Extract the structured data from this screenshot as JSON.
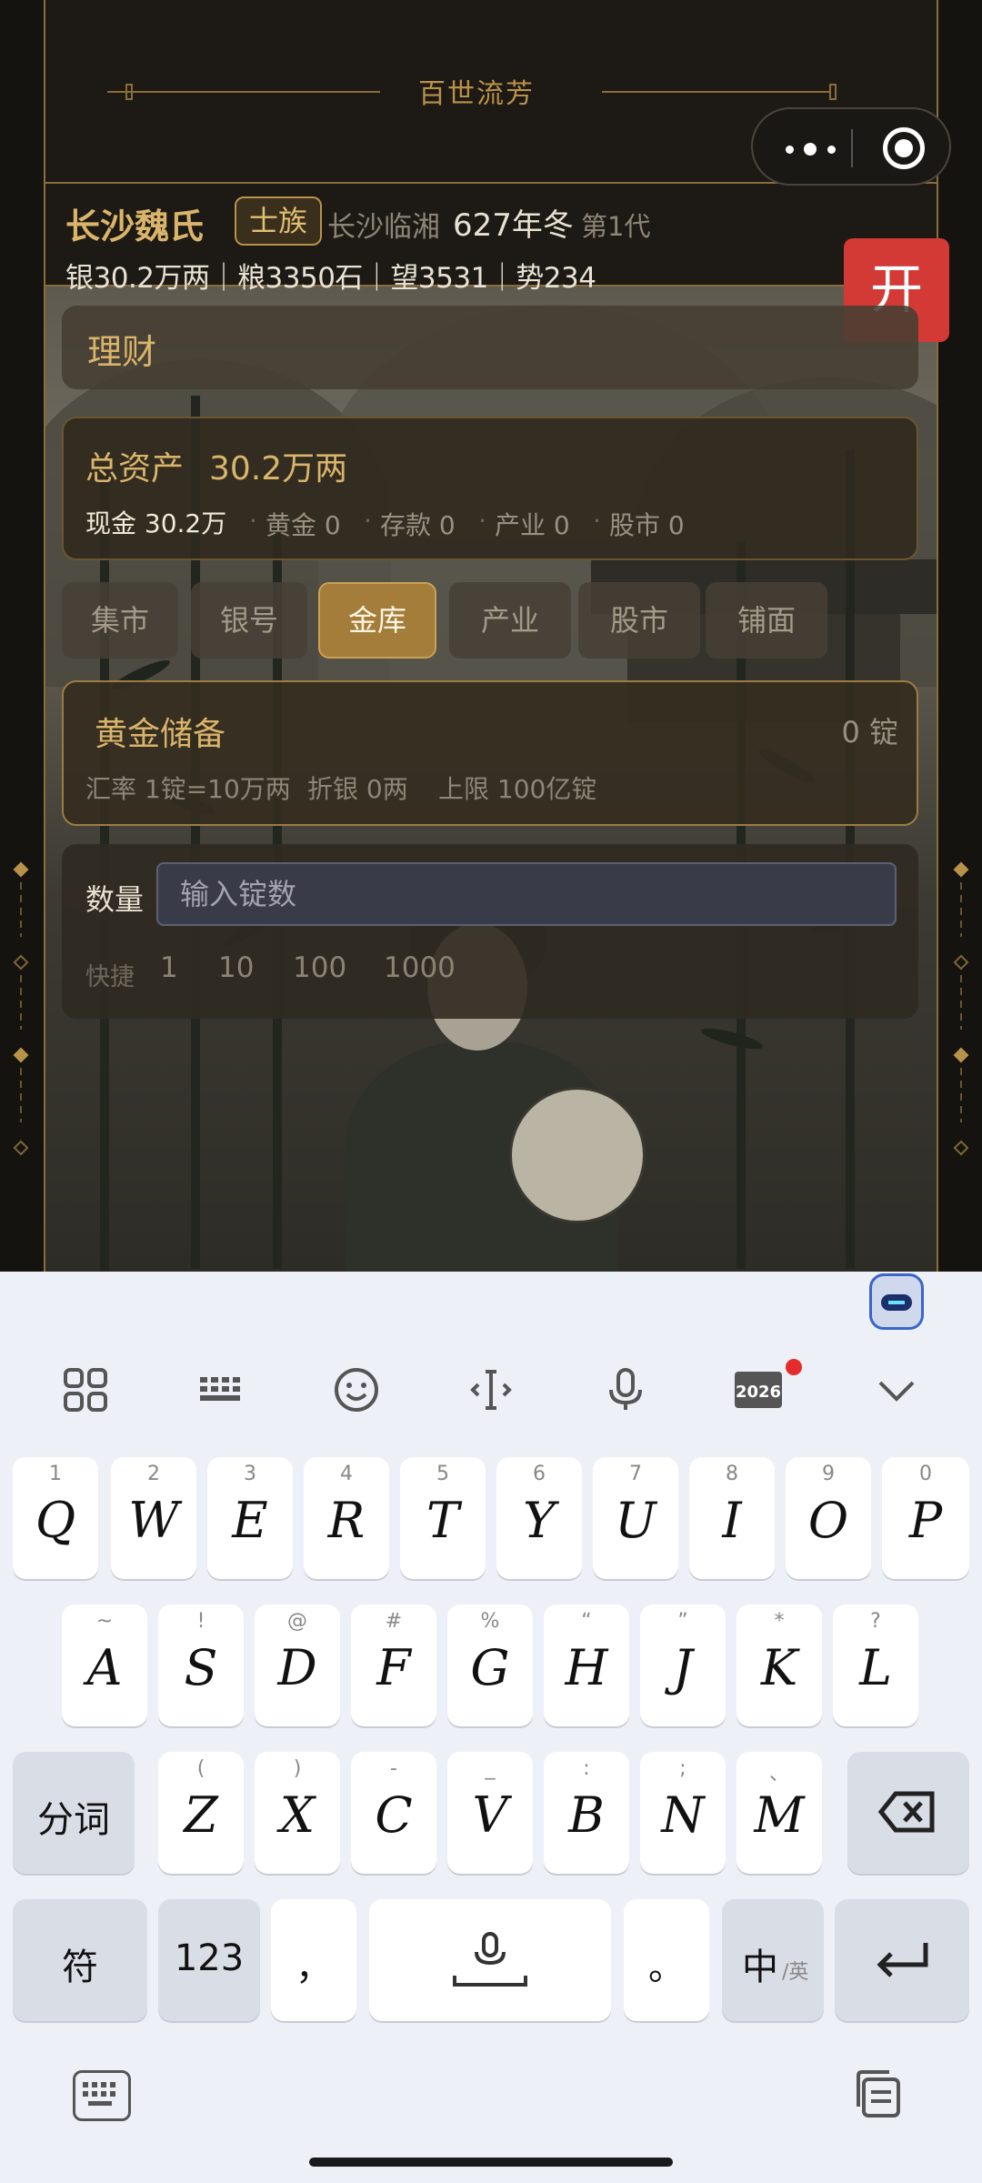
{
  "header": {
    "title": "百世流芳",
    "clan_name": "长沙魏氏",
    "clan_rank": "士族",
    "place": "长沙临湘",
    "date": "627年冬",
    "generation": "第1代",
    "stats": "银30.2万两｜粮3350石｜望3531｜势234",
    "open_button": "开"
  },
  "main": {
    "section_tab": "理财",
    "assets": {
      "title": "总资产",
      "value": "30.2万两",
      "cash": "现金 30.2万",
      "gold": "黄金 0",
      "deposit": "存款 0",
      "industry": "产业 0",
      "stock": "股市 0"
    },
    "subtabs": [
      "集市",
      "银号",
      "金库",
      "产业",
      "股市",
      "铺面"
    ],
    "active_subtab": "金库",
    "gold": {
      "title": "黄金储备",
      "count": "0 锭",
      "rate": "汇率 1锭=10万两",
      "silver": "折银 0两",
      "limit": "上限 100亿锭"
    },
    "quantity": {
      "label": "数量",
      "placeholder": "输入锭数",
      "quick_label": "快捷",
      "quick": [
        "1",
        "10",
        "100",
        "1000"
      ]
    }
  },
  "keyboard": {
    "toolbar": [
      "grid-icon",
      "keyboard-layout-icon",
      "emoji-icon",
      "cursor-icon",
      "microphone-icon",
      "calendar-2026-icon",
      "collapse-icon"
    ],
    "toolbar_badge": "2026",
    "row1": [
      {
        "key": "Q",
        "hint": "1"
      },
      {
        "key": "W",
        "hint": "2"
      },
      {
        "key": "E",
        "hint": "3"
      },
      {
        "key": "R",
        "hint": "4"
      },
      {
        "key": "T",
        "hint": "5"
      },
      {
        "key": "Y",
        "hint": "6"
      },
      {
        "key": "U",
        "hint": "7"
      },
      {
        "key": "I",
        "hint": "8"
      },
      {
        "key": "O",
        "hint": "9"
      },
      {
        "key": "P",
        "hint": "0"
      }
    ],
    "row2": [
      {
        "key": "A",
        "hint": "~"
      },
      {
        "key": "S",
        "hint": "!"
      },
      {
        "key": "D",
        "hint": "@"
      },
      {
        "key": "F",
        "hint": "#"
      },
      {
        "key": "G",
        "hint": "%"
      },
      {
        "key": "H",
        "hint": "“"
      },
      {
        "key": "J",
        "hint": "”"
      },
      {
        "key": "K",
        "hint": "*"
      },
      {
        "key": "L",
        "hint": "?"
      }
    ],
    "row3": [
      {
        "key": "Z",
        "hint": "("
      },
      {
        "key": "X",
        "hint": ")"
      },
      {
        "key": "C",
        "hint": "-"
      },
      {
        "key": "V",
        "hint": "_"
      },
      {
        "key": "B",
        "hint": ":"
      },
      {
        "key": "N",
        "hint": ";"
      },
      {
        "key": "M",
        "hint": "、"
      }
    ],
    "split_word": "分词",
    "symbols": "符",
    "numbers": "123",
    "comma": "，",
    "period": "。",
    "lang": "中",
    "lang_sub": "/英"
  },
  "colors": {
    "accent_gold": "#d9b46a",
    "active_tab": "#a47d3a",
    "open_button": "#d33a36"
  }
}
